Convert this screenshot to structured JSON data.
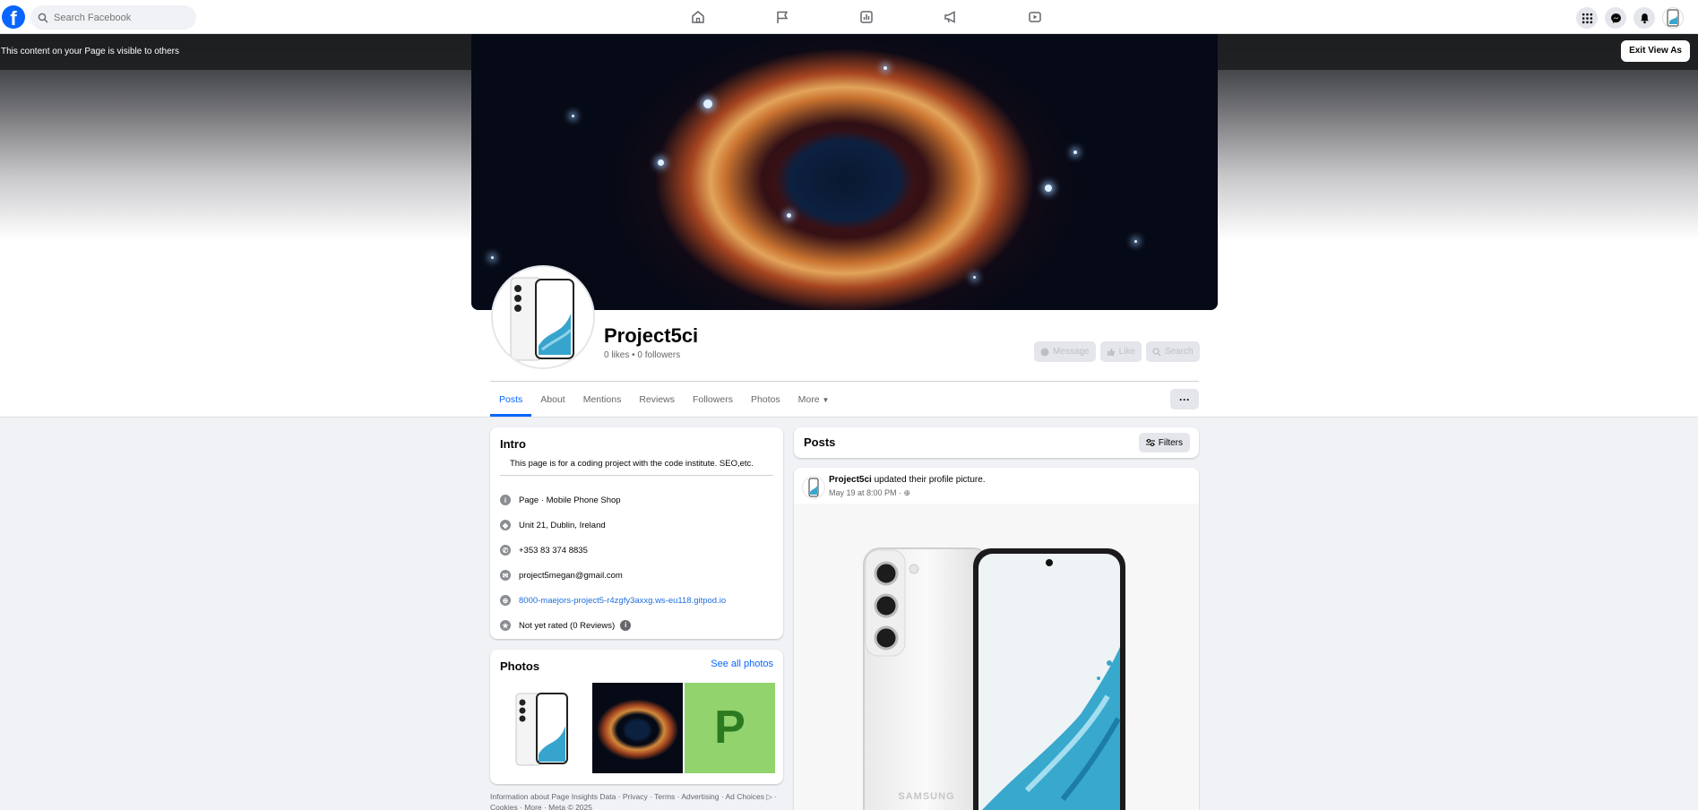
{
  "topbar": {
    "logo_glyph": "f",
    "search_placeholder": "Search Facebook",
    "nav_icons": [
      "home-icon",
      "flag-icon",
      "chart-icon",
      "megaphone-icon",
      "video-icon"
    ],
    "right_icons": [
      "menu-grid-icon",
      "messenger-icon",
      "bell-icon"
    ]
  },
  "banner": {
    "text": "This content on your Page is visible to others",
    "exit_label": "Exit View As"
  },
  "page": {
    "name": "Project5ci",
    "stats": "0 likes • 0 followers",
    "actions": [
      "Message",
      "Like",
      "Search"
    ]
  },
  "tabs": [
    "Posts",
    "About",
    "Mentions",
    "Reviews",
    "Followers",
    "Photos",
    "More"
  ],
  "more_glyph": "···",
  "intro": {
    "title": "Intro",
    "bio": "This page is for a coding project with the code institute. SEO,etc.",
    "rows": [
      {
        "icon": "info-icon",
        "glyph": "i",
        "text": "Page · Mobile Phone Shop"
      },
      {
        "icon": "location-icon",
        "glyph": "◆",
        "text": "Unit 21, Dublin, Ireland"
      },
      {
        "icon": "phone-icon",
        "glyph": "✆",
        "text": "+353 83 374 8835"
      },
      {
        "icon": "email-icon",
        "glyph": "✉",
        "text": "project5megan@gmail.com"
      },
      {
        "icon": "globe-icon",
        "glyph": "⊕",
        "text": "8000-maejors-project5-r4zgfy3axxg.ws-eu118.gitpod.io"
      },
      {
        "icon": "star-icon",
        "glyph": "★",
        "text": "Not yet rated (0 Reviews)"
      }
    ],
    "rating_info_glyph": "i"
  },
  "photos": {
    "title": "Photos",
    "see_all": "See all photos",
    "p_letter": "P"
  },
  "footer": "Information about Page Insights Data · Privacy · Terms · Advertising · Ad Choices ▷ · Cookies · More · Meta © 2025",
  "posts": {
    "title": "Posts",
    "filters_label": "Filters"
  },
  "post": {
    "author": "Project5ci",
    "action": "updated their profile picture.",
    "meta": "May 19 at 8:00 PM · ",
    "privacy_icon": "globe-icon",
    "brand_text": "SAMSUNG"
  },
  "colors": {
    "accent": "#0866ff",
    "link": "#216fdb",
    "background": "#f0f2f5"
  }
}
